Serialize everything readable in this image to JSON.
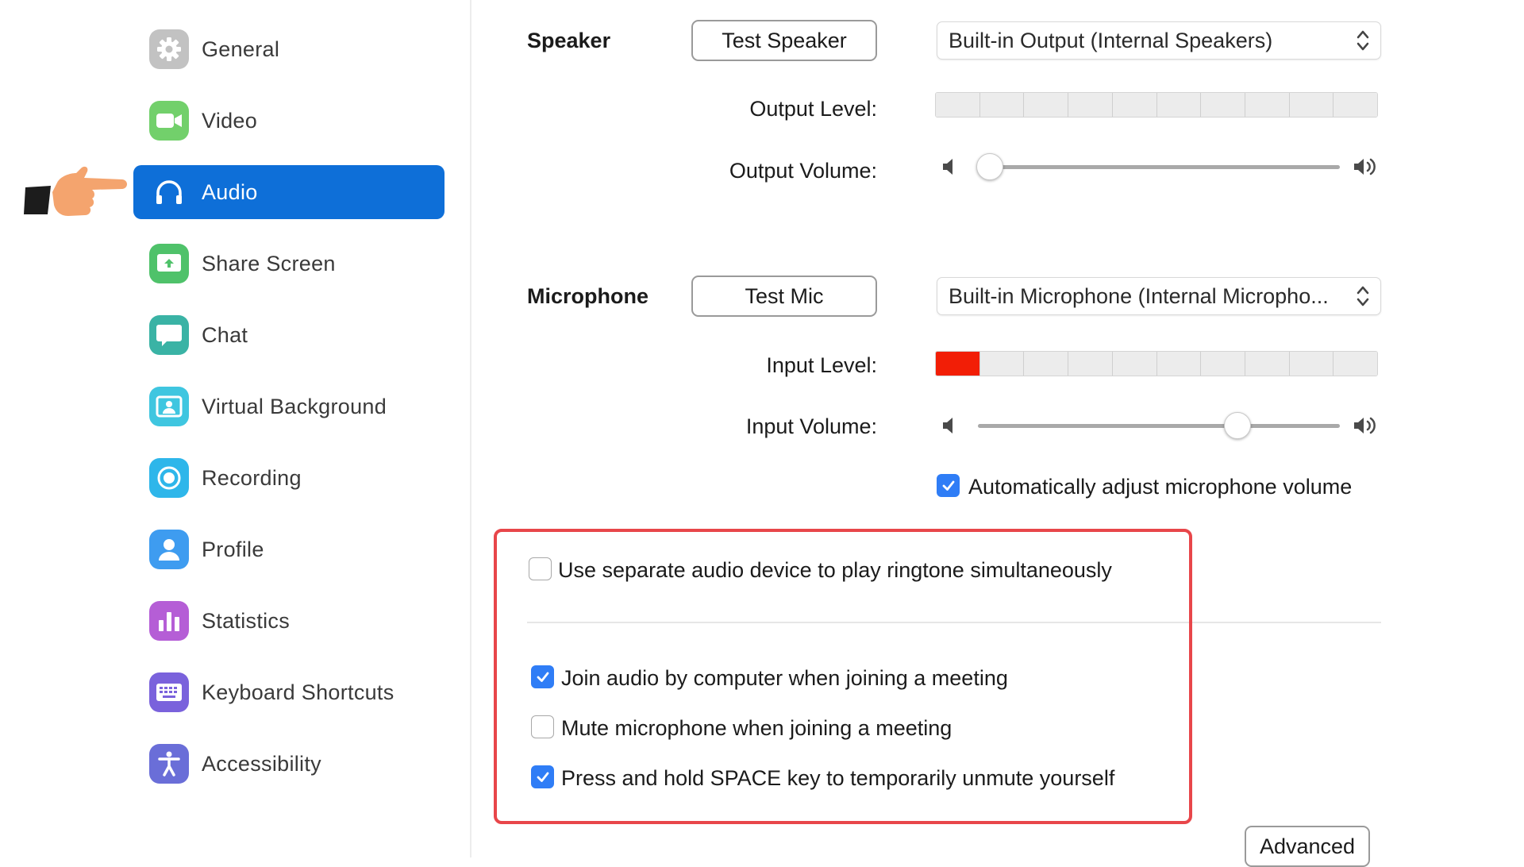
{
  "sidebar": {
    "items": [
      {
        "label": "General",
        "icon": "gear-icon",
        "color": "#bdbdbd"
      },
      {
        "label": "Video",
        "icon": "video-camera-icon",
        "color": "#6fcf6a"
      },
      {
        "label": "Audio",
        "icon": "headphones-icon",
        "color": "#0e6fd8",
        "active": true
      },
      {
        "label": "Share Screen",
        "icon": "share-screen-icon",
        "color": "#4fc26a"
      },
      {
        "label": "Chat",
        "icon": "chat-bubble-icon",
        "color": "#3ab3a5"
      },
      {
        "label": "Virtual Background",
        "icon": "person-frame-icon",
        "color": "#3fc6e0"
      },
      {
        "label": "Recording",
        "icon": "record-icon",
        "color": "#2eb6ea"
      },
      {
        "label": "Profile",
        "icon": "user-icon",
        "color": "#3e9cf0"
      },
      {
        "label": "Statistics",
        "icon": "bar-chart-icon",
        "color": "#b55ed6"
      },
      {
        "label": "Keyboard Shortcuts",
        "icon": "keyboard-icon",
        "color": "#7a62dc"
      },
      {
        "label": "Accessibility",
        "icon": "accessibility-icon",
        "color": "#6a6ed8"
      }
    ]
  },
  "speaker": {
    "title": "Speaker",
    "test_button": "Test Speaker",
    "device": "Built-in Output (Internal Speakers)",
    "output_level_label": "Output Level:",
    "output_level_active_segments": 0,
    "output_volume_label": "Output Volume:",
    "output_volume": 0.0
  },
  "microphone": {
    "title": "Microphone",
    "test_button": "Test Mic",
    "device": "Built-in Microphone (Internal Micropho...",
    "input_level_label": "Input Level:",
    "input_level_active_segments": 1,
    "input_volume_label": "Input Volume:",
    "input_volume": 0.74,
    "auto_adjust_label": "Automatically adjust microphone volume",
    "auto_adjust": true
  },
  "options": {
    "separate_device_label": "Use separate audio device to play ringtone simultaneously",
    "separate_device": false,
    "join_audio_label": "Join audio by computer when joining a meeting",
    "join_audio": true,
    "mute_label": "Mute microphone when joining a meeting",
    "mute": false,
    "space_label": "Press and hold SPACE key to temporarily unmute yourself",
    "space": true
  },
  "advanced_button": "Advanced",
  "colors": {
    "accent": "#0e6fd8",
    "checkbox": "#2f7df6",
    "level_on": "#f21e06",
    "highlight": "#e8464a",
    "pointer_hand": "#f4a46e"
  }
}
